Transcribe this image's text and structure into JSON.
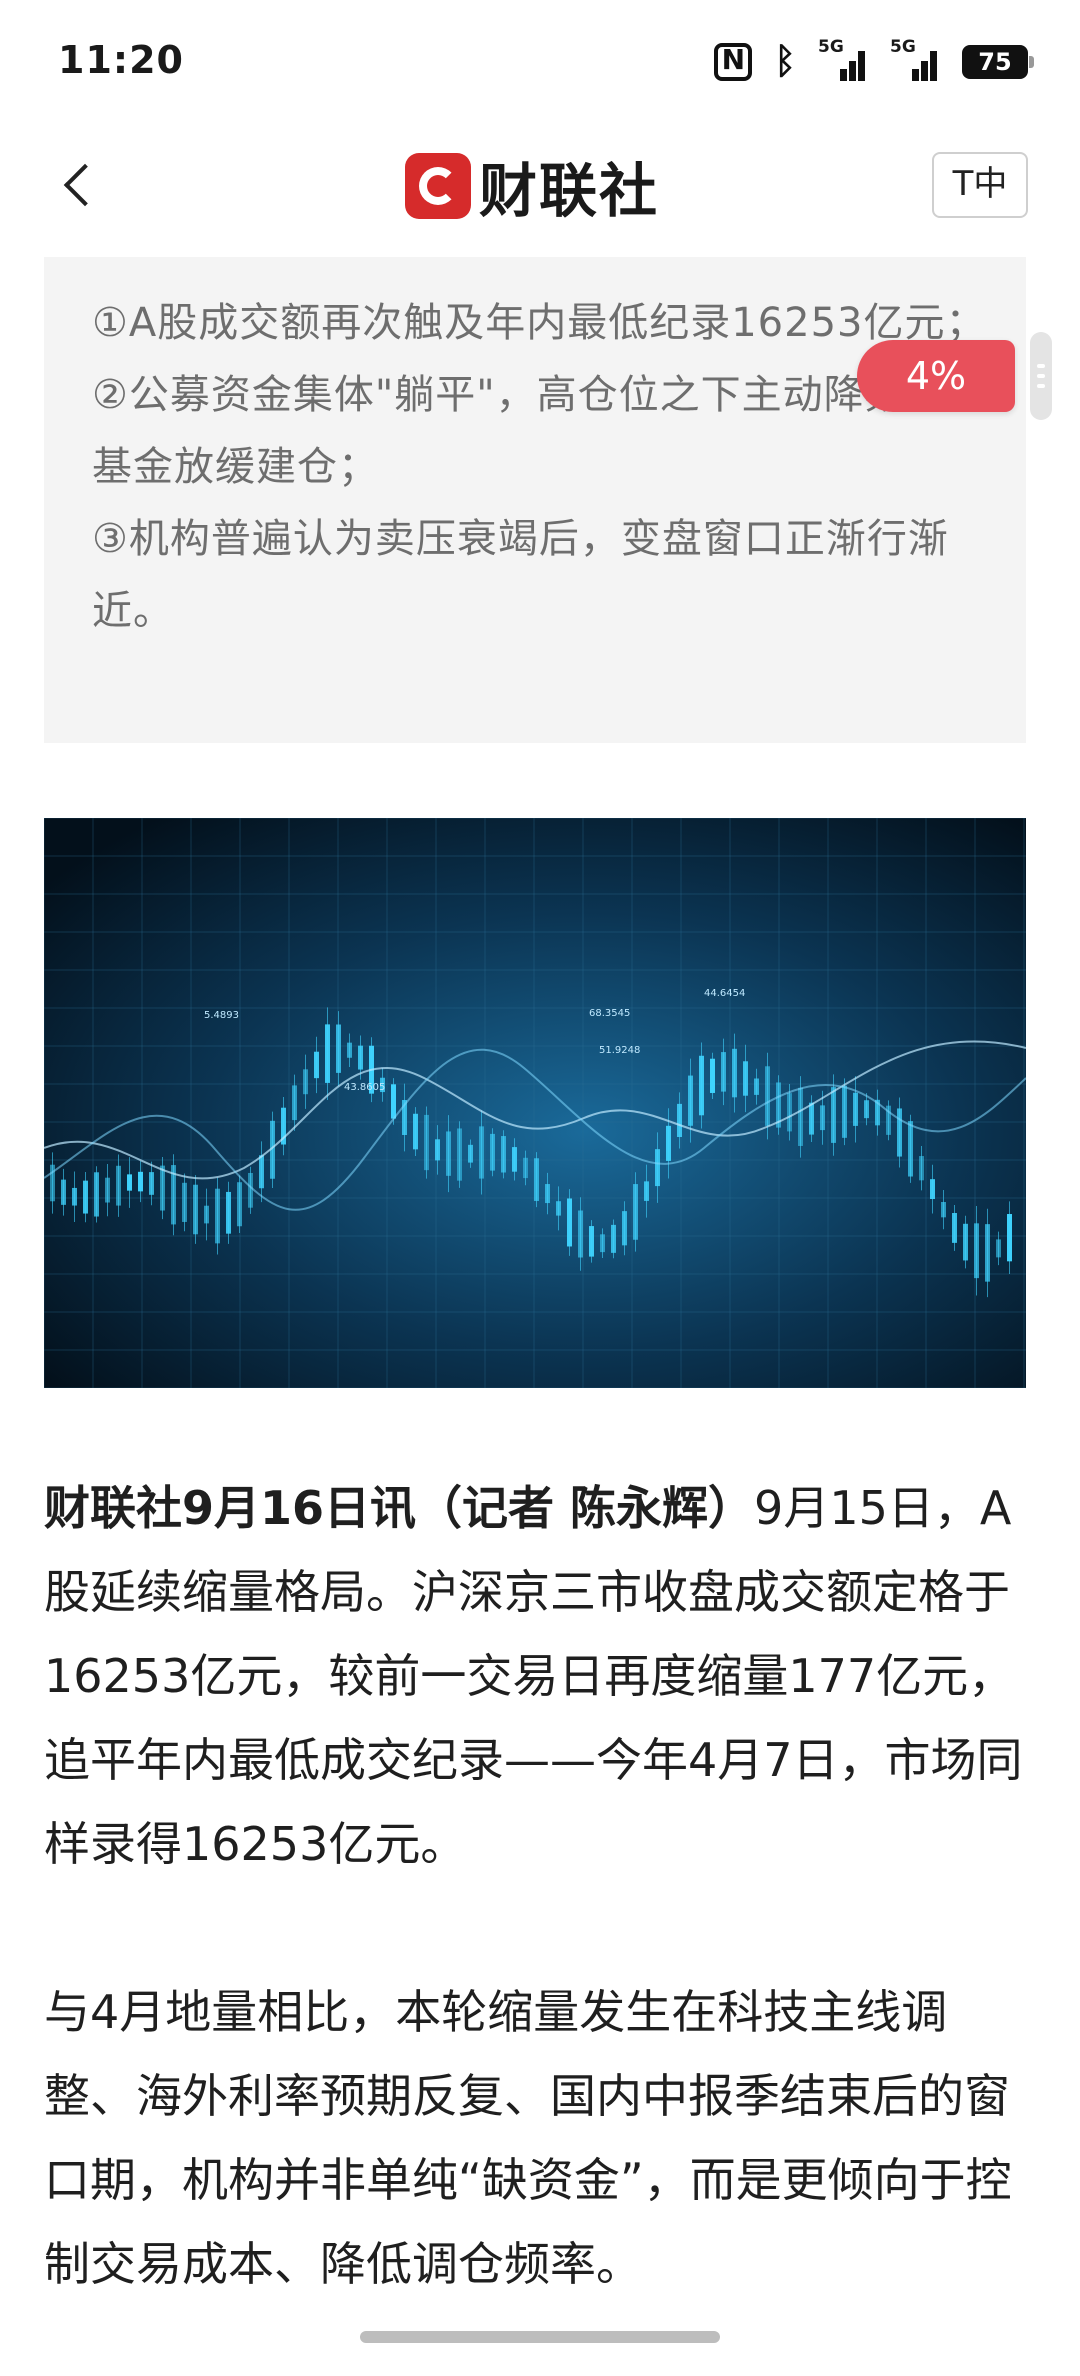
{
  "status_bar": {
    "time": "11:20",
    "signal_1_label": "5G",
    "signal_2_label": "5G",
    "battery": "75",
    "icons": [
      "nfc-icon",
      "bluetooth-icon",
      "signal-5g-icon",
      "signal-5g-icon",
      "battery-icon"
    ]
  },
  "nav": {
    "logo_text": "财联社",
    "font_size_label": "T中"
  },
  "summary": {
    "items": [
      "①A股成交额再次触及年内最低纪录16253亿元；",
      "②公募资金集体\"躺平\"，高仓位之下主动降频、新基金放缓建仓；",
      "③机构普遍认为卖压衰竭后，变盘窗口正渐行渐近。"
    ]
  },
  "reading_progress": "4%",
  "hero_image": {
    "description_icon": "stock-chart-image",
    "labels": [
      "5.4893",
      "43.8605",
      "68.3545",
      "51.9248",
      "44.6454"
    ],
    "accent_color": "#3fd4ff"
  },
  "article": {
    "dateline": "财联社9月16日讯（记者 陈永辉）",
    "p1_rest": "9月15日，A股延续缩量格局。沪深京三市收盘成交额定格于16253亿元，较前一交易日再度缩量177亿元，追平年内最低成交纪录——今年4月7日，市场同样录得16253亿元。",
    "p2": "与4月地量相比，本轮缩量发生在科技主线调整、海外利率预期反复、国内中报季结束后的窗口期，机构并非单纯“缺资金”，而是更倾向于控制交易成本、降低调仓频率。"
  },
  "colors": {
    "brand_red": "#d62b2b",
    "badge_red": "#e8505b",
    "summary_bg": "#f4f4f4",
    "summary_text": "#6e6e6e"
  }
}
